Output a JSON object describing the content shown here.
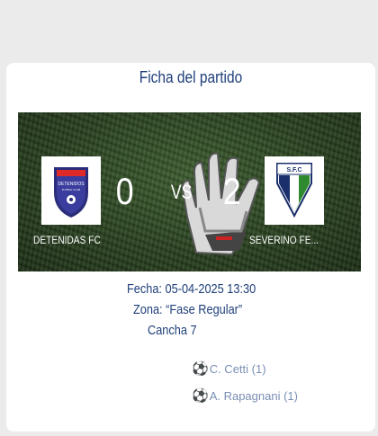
{
  "card": {
    "title": "Ficha del partido"
  },
  "match": {
    "home": {
      "name": "DETENIDAS FC",
      "score": "0",
      "logo_text": "DETENIDOS",
      "logo_sub": "FUTBOL CLUB"
    },
    "away": {
      "name": "SEVERINO FE...",
      "score": "2",
      "logo_text": "S.F.C"
    },
    "vs": "VS"
  },
  "details": {
    "fecha": "Fecha: 05-04-2025 13:30",
    "zona": "Zona: “Fase Regular”",
    "cancha": "Cancha 7"
  },
  "scorers": [
    {
      "icon": "⚽",
      "text": "C. Cetti (1)"
    },
    {
      "icon": "⚽",
      "text": "A. Rapagnani (1)"
    }
  ],
  "colors": {
    "title": "#1f3f7a",
    "scorer": "#7a8fb5",
    "background": "#ebebeb"
  },
  "icons": {
    "scorer": "soccer-ball-icon"
  }
}
